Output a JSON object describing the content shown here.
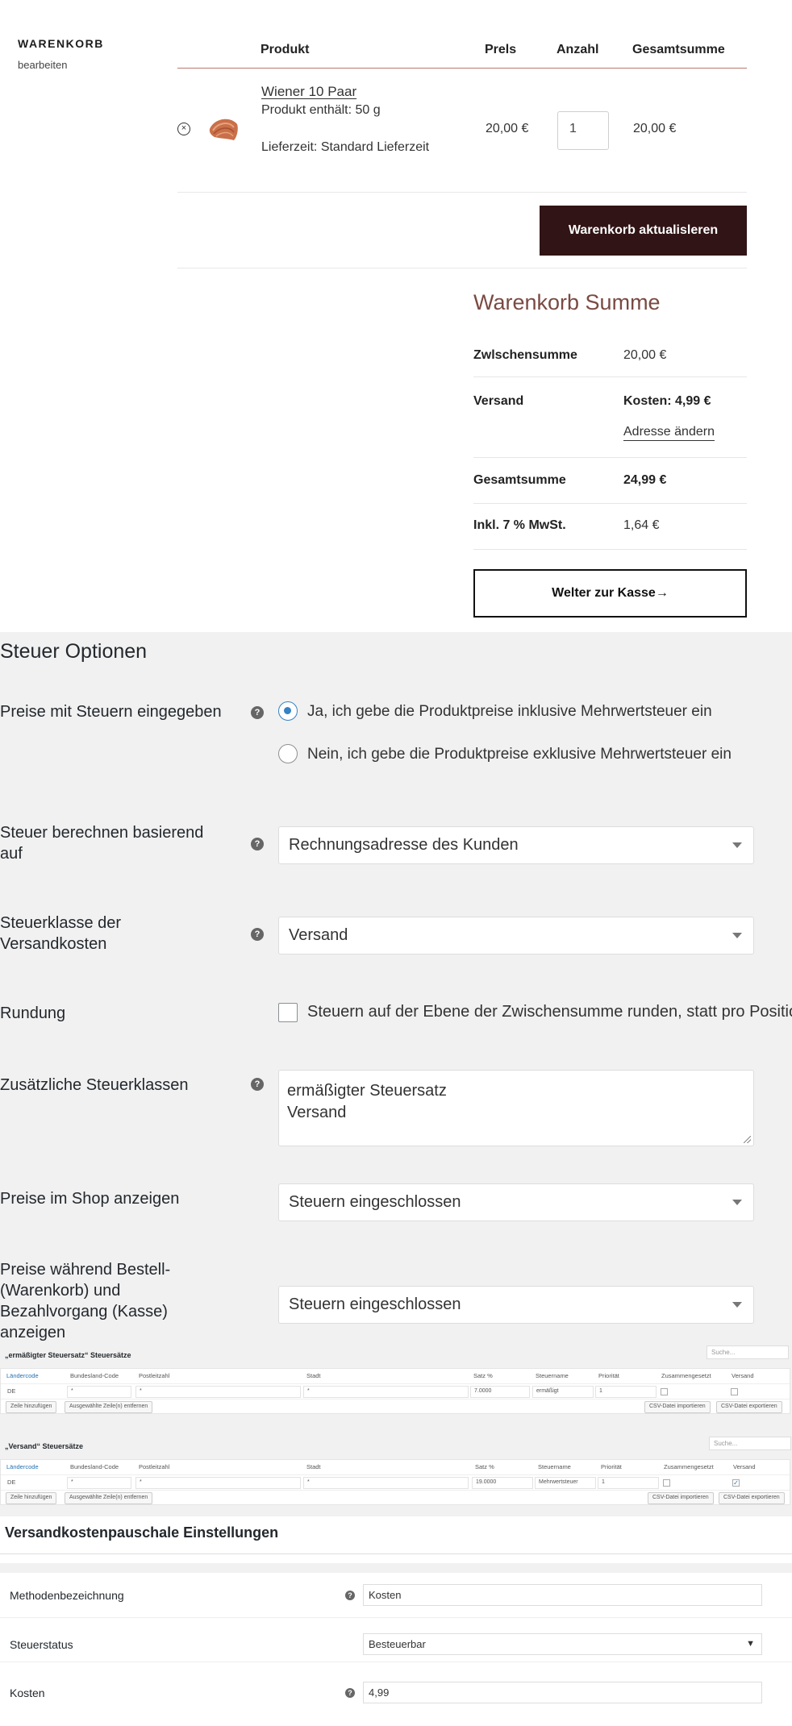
{
  "cart": {
    "sidebar_title": "WARENKORB",
    "sidebar_sub": "bearbeiten",
    "headers": {
      "product": "Produkt",
      "price": "Prels",
      "qty": "Anzahl",
      "total": "Gesamtsumme"
    },
    "item": {
      "remove_icon": "×",
      "name": "Wiener 10 Paar",
      "contents": "Produkt enthält: 50 g",
      "delivery": "Lieferzeit: Standard Lieferzeit",
      "price": "20,00 €",
      "qty": "1",
      "total": "20,00 €"
    },
    "update_button": "Warenkorb aktualisleren",
    "summary": {
      "title": "Warenkorb Summe",
      "subtotal_label": "Zwlschensumme",
      "subtotal_value": "20,00 €",
      "shipping_label": "Versand",
      "shipping_value": "Kosten: 4,99 €",
      "change_address": "Adresse ändern",
      "total_label": "Gesamtsumme",
      "total_value": "24,99 €",
      "vat_label": "Inkl. 7 % MwSt.",
      "vat_value": "1,64 €"
    },
    "checkout_button": "Welter zur Kasse→"
  },
  "tax": {
    "heading": "Steuer Optionen",
    "help_glyph": "?",
    "prices_with_tax": {
      "label": "Preise mit Steuern eingegeben",
      "option_yes": "Ja, ich gebe die Produktpreise inklusive Mehrwertsteuer ein",
      "option_no": "Nein, ich gebe die Produktpreise exklusive Mehrwertsteuer ein"
    },
    "calc_based_on": {
      "label_line1": "Steuer berechnen basierend",
      "label_line2": "auf",
      "value": "Rechnungsadresse des Kunden"
    },
    "shipping_tax_class": {
      "label_line1": "Steuerklasse der",
      "label_line2": "Versandkosten",
      "value": "Versand"
    },
    "rounding": {
      "label": "Rundung",
      "text": "Steuern auf der Ebene der Zwischensumme runden, statt pro Position"
    },
    "additional_classes": {
      "label": "Zusätzliche Steuerklassen",
      "line1": "ermäßigter Steuersatz",
      "line2": "Versand"
    },
    "shop_display": {
      "label": "Preise im Shop anzeigen",
      "value": "Steuern eingeschlossen"
    },
    "cart_display": {
      "label_line1": "Preise während Bestell-",
      "label_line2": "(Warenkorb) und",
      "label_line3": "Bezahlvorgang (Kasse)",
      "label_line4": "anzeigen",
      "value": "Steuern eingeschlossen"
    },
    "rate_tables": {
      "columns": [
        "Ländercode",
        "Bundesland-Code",
        "Postleitzahl",
        "Stadt",
        "Satz %",
        "Steuername",
        "Priorität",
        "Zusammengesetzt",
        "Versand"
      ],
      "search_placeholder": "Suche...",
      "add_row": "Zeile hinzufügen",
      "remove_rows": "Ausgewählte Zeile(n) entfernen",
      "import_csv": "CSV-Datei importieren",
      "export_csv": "CSV-Datei exportieren",
      "reduced": {
        "title": "„ermäßigter Steuersatz“ Steuersätze",
        "row": {
          "country": "DE",
          "state": "*",
          "postcode": "*",
          "city": "*",
          "rate": "7.0000",
          "name": "ermäßigt",
          "priority": "1",
          "shipping_check": ""
        }
      },
      "shipping": {
        "title": "„Versand“ Steuersätze",
        "row": {
          "country": "DE",
          "state": "*",
          "postcode": "*",
          "city": "*",
          "rate": "19.0000",
          "name": "Mehrwertsteuer",
          "priority": "1",
          "shipping_check": "✓"
        }
      }
    }
  },
  "shipping": {
    "heading": "Versandkostenpauschale Einstellungen",
    "method_label": "Methodenbezeichnung",
    "method_value": "Kosten",
    "status_label": "Steuerstatus",
    "status_value": "Besteuerbar",
    "status_caret": "▼",
    "cost_label": "Kosten",
    "cost_value": "4,99"
  }
}
